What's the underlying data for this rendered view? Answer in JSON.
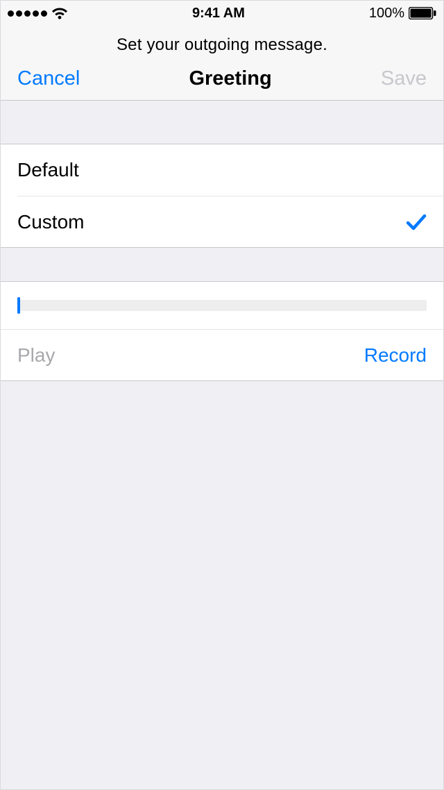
{
  "status_bar": {
    "time": "9:41 AM",
    "battery_percent": "100%"
  },
  "header": {
    "subtitle": "Set your outgoing message.",
    "cancel_label": "Cancel",
    "title": "Greeting",
    "save_label": "Save"
  },
  "options": {
    "default_label": "Default",
    "custom_label": "Custom",
    "selected": "custom"
  },
  "actions": {
    "play_label": "Play",
    "record_label": "Record"
  }
}
